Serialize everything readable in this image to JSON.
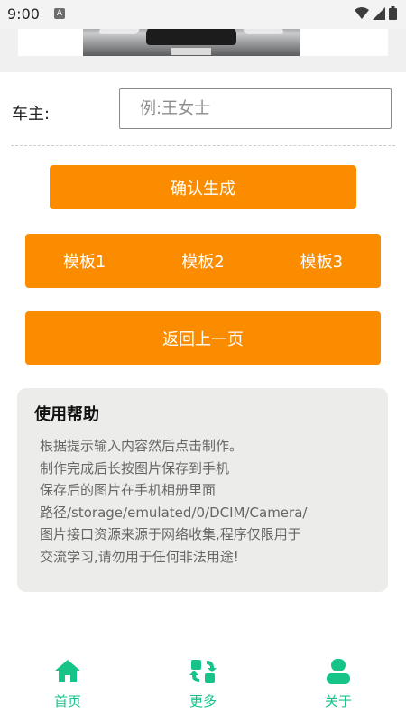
{
  "status_bar": {
    "time": "9:00",
    "notification_icon": "A"
  },
  "owner": {
    "label": "车主:",
    "placeholder": "例:王女士",
    "value": ""
  },
  "buttons": {
    "confirm": "确认生成",
    "templates": [
      "模板1",
      "模板2",
      "模板3"
    ],
    "back": "返回上一页"
  },
  "help": {
    "title": "使用帮助",
    "lines": [
      "根据提示输入内容然后点击制作。",
      "制作完成后长按图片保存到手机",
      "保存后的图片在手机相册里面",
      "路径/storage/emulated/0/DCIM/Camera/",
      "图片接口资源来源于网络收集,程序仅限用于",
      "交流学习,请勿用于任何非法用途!"
    ]
  },
  "nav": {
    "items": [
      {
        "label": "首页",
        "icon": "home-icon"
      },
      {
        "label": "更多",
        "icon": "more-icon"
      },
      {
        "label": "关于",
        "icon": "about-icon"
      }
    ]
  },
  "colors": {
    "accent": "#fb8c00",
    "nav": "#16c488",
    "card": "#ecedeb"
  }
}
